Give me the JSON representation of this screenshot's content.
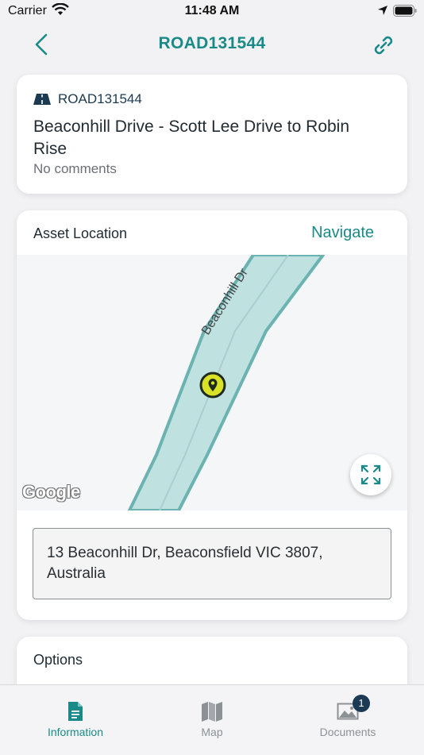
{
  "status_bar": {
    "carrier": "Carrier",
    "time": "11:48 AM"
  },
  "nav": {
    "title": "ROAD131544",
    "accent_color": "#1a8a88"
  },
  "asset": {
    "id": "ROAD131544",
    "name": "Beaconhill Drive - Scott Lee Drive to Robin Rise",
    "comments": "No comments",
    "icon": "road-icon"
  },
  "location": {
    "header": "Asset Location",
    "navigate_label": "Navigate",
    "map": {
      "street_label": "Beaconhill Dr",
      "attribution": "Google",
      "marker_icon": "map-pin-icon",
      "expand_icon": "expand-icon"
    },
    "address": "13 Beaconhill Dr, Beaconsfield VIC 3807, Australia"
  },
  "options": {
    "header": "Options"
  },
  "tabs": [
    {
      "label": "Information",
      "icon": "document-icon",
      "active": true
    },
    {
      "label": "Map",
      "icon": "map-icon",
      "active": false
    },
    {
      "label": "Documents",
      "icon": "image-icon",
      "active": false,
      "badge": "1"
    }
  ]
}
